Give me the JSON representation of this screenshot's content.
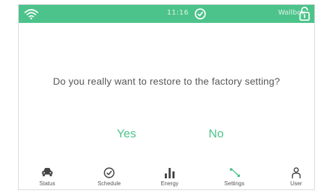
{
  "status_bar": {
    "time": "11:16",
    "device_name": "Wallbox",
    "background_color": "#4cc38a",
    "icons": [
      "wifi-icon",
      "clock-icon",
      "unlock-icon"
    ]
  },
  "dialog": {
    "message": "Do you really want to restore to the factory setting?",
    "confirm_label": "Yes",
    "cancel_label": "No",
    "accent_color": "#4cc38a"
  },
  "nav": {
    "items": [
      {
        "label": "Status",
        "icon": "car-icon"
      },
      {
        "label": "Schedule",
        "icon": "clock-icon"
      },
      {
        "label": "Energy",
        "icon": "bar-chart-icon"
      },
      {
        "label": "Settings",
        "icon": "wrench-icon",
        "active": true
      },
      {
        "label": "User",
        "icon": "user-icon"
      }
    ],
    "active_color": "#4cc38a",
    "inactive_color": "#444444"
  }
}
